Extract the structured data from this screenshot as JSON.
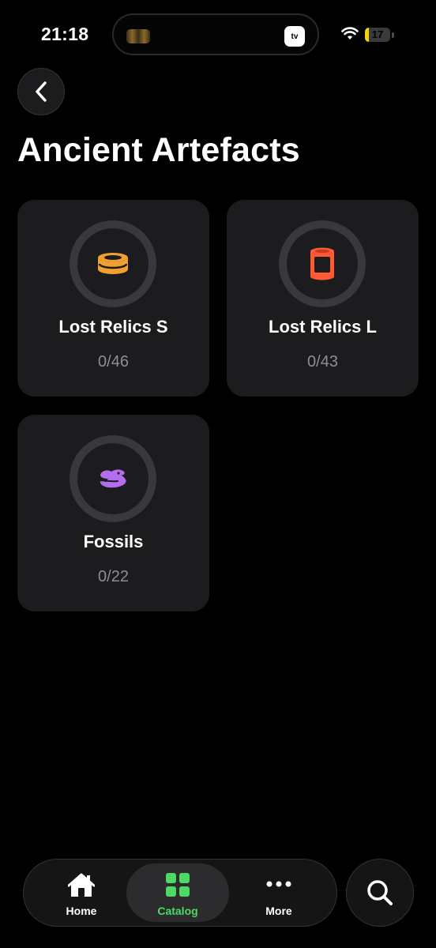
{
  "status_bar": {
    "time": "21:18",
    "activity_badge": "tv",
    "battery_level": "17",
    "battery_fraction": 0.17
  },
  "page": {
    "title": "Ancient Artefacts"
  },
  "collections": [
    {
      "name": "Lost Relics S",
      "count": "0/46",
      "icon": "small-tin-icon",
      "color": "#f0a030"
    },
    {
      "name": "Lost Relics L",
      "count": "0/43",
      "icon": "large-can-icon",
      "color": "#ff5a36"
    },
    {
      "name": "Fossils",
      "count": "0/22",
      "icon": "fossil-icon",
      "color": "#b36ef0"
    }
  ],
  "tab_bar": {
    "tabs": [
      {
        "label": "Home",
        "icon": "home-icon"
      },
      {
        "label": "Catalog",
        "icon": "grid-icon",
        "active": true
      },
      {
        "label": "More",
        "icon": "ellipsis-icon"
      }
    ],
    "accent": "#4cd964"
  },
  "search": {
    "icon": "search-icon"
  }
}
